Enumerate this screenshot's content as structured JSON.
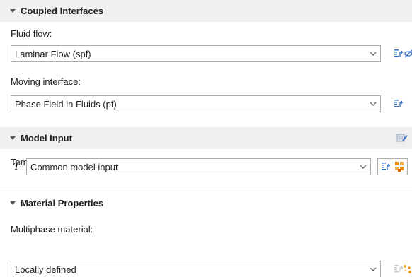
{
  "sections": {
    "coupled": {
      "title": "Coupled Interfaces"
    },
    "model_input": {
      "title": "Model Input"
    },
    "material": {
      "title": "Material Properties"
    }
  },
  "fluid_flow": {
    "label": "Fluid flow:",
    "value": "Laminar Flow (spf)"
  },
  "moving_interface": {
    "label": "Moving interface:",
    "value": "Phase Field in Fluids (pf)"
  },
  "temperature": {
    "label": "Temperature:",
    "symbol": "T",
    "value": "Common model input"
  },
  "multiphase": {
    "label": "Multiphase material:",
    "value": "Locally defined"
  },
  "colors": {
    "header_bg": "#f0f0f0",
    "go_to_source_icon": "#2f6bbd",
    "unlink_icon": "#3a6fc7",
    "orange_icon": "#f08a00"
  }
}
